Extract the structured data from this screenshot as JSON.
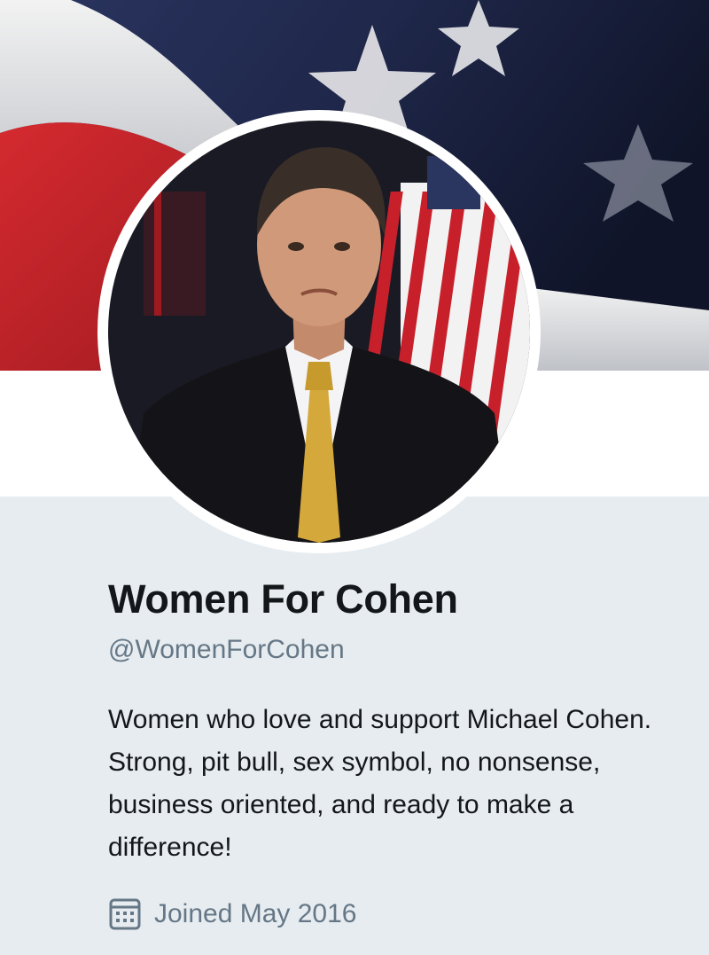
{
  "profile": {
    "display_name": "Women For Cohen",
    "handle": "@WomenForCohen",
    "bio": "Women who love and support Michael Cohen. Strong, pit bull, sex symbol, no nonsense, business oriented, and ready to make a difference!",
    "joined": "Joined May 2016",
    "joined_icon": "calendar-icon"
  },
  "colors": {
    "page_bg": "#e6ecf0",
    "name_text": "#14171a",
    "secondary_text": "#657786",
    "flag_red": "#c8202b",
    "flag_blue": "#1e2547"
  }
}
